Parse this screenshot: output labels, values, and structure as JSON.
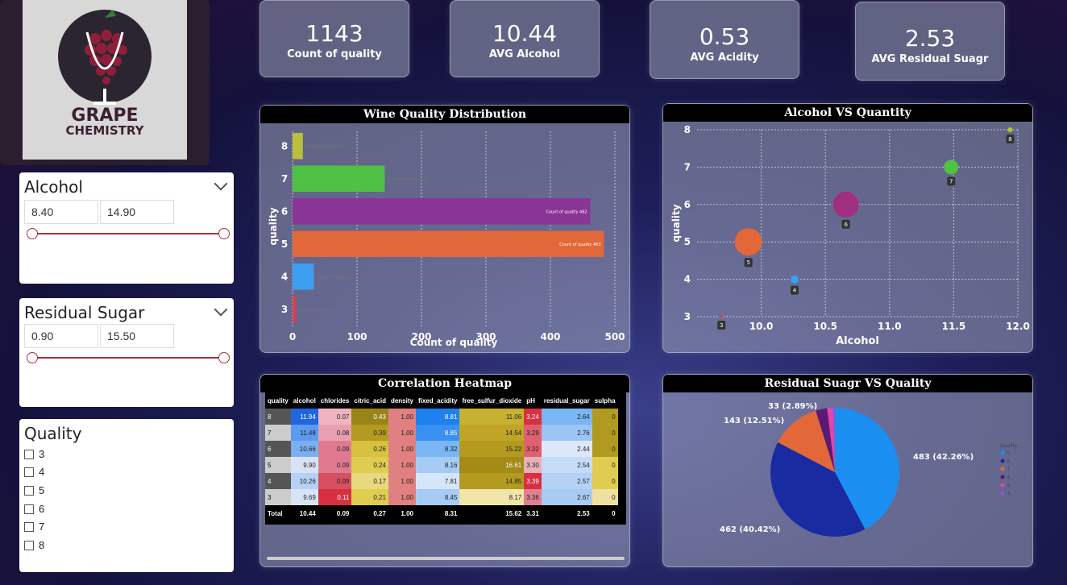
{
  "logo": {
    "line1": "GRAPE",
    "line2": "CHEMISTRY"
  },
  "kpis": [
    {
      "value": "1143",
      "label": "Count of quality"
    },
    {
      "value": "10.44",
      "label": "AVG Alcohol"
    },
    {
      "value": "0.53",
      "label": "AVG Acidity"
    },
    {
      "value": "2.53",
      "label": "AVG Residual Suagr"
    }
  ],
  "slicers": {
    "alcohol": {
      "title": "Alcohol",
      "min": "8.40",
      "max": "14.90"
    },
    "sugar": {
      "title": "Residual Sugar",
      "min": "0.90",
      "max": "15.50"
    },
    "quality": {
      "title": "Quality",
      "items": [
        "3",
        "4",
        "5",
        "6",
        "7",
        "8"
      ]
    }
  },
  "charts": {
    "bar_title": "Wine Quality Distribution",
    "scatter_title": "Alcohol VS Quantity",
    "heatmap_title": "Correlation Heatmap",
    "pie_title": "Residual Suagr VS Quality"
  },
  "chart_data": [
    {
      "type": "bar",
      "orientation": "horizontal",
      "title": "Wine Quality Distribution",
      "xlabel": "Count of quality",
      "ylabel": "quality",
      "categories": [
        "8",
        "7",
        "6",
        "5",
        "4",
        "3"
      ],
      "values": [
        16,
        143,
        462,
        483,
        33,
        6
      ],
      "colors": [
        "#b9c03a",
        "#4fc245",
        "#8a3596",
        "#e2683a",
        "#3d9ef2",
        "#d6404f"
      ],
      "data_labels": [
        "Count of quality 16",
        "Count of quality 143",
        "Count of quality 462",
        "Count of quality 483",
        "Count of quality 33",
        "Count of quality 6"
      ],
      "xticks": [
        "0",
        "100",
        "200",
        "300",
        "400",
        "500"
      ],
      "xlim": [
        0,
        500
      ]
    },
    {
      "type": "scatter",
      "title": "Alcohol VS Quantity",
      "xlabel": "Alcohol",
      "ylabel": "quality",
      "xticks": [
        "10.0",
        "10.5",
        "11.0",
        "11.5",
        "12.0"
      ],
      "yticks": [
        "3",
        "4",
        "5",
        "6",
        "7",
        "8"
      ],
      "xlim": [
        9.5,
        12.0
      ],
      "ylim": [
        3,
        8
      ],
      "points": [
        {
          "label": "3",
          "x": 9.69,
          "y": 3,
          "size": 2,
          "color": "#d6404f"
        },
        {
          "label": "4",
          "x": 10.26,
          "y": 4,
          "size": 5,
          "color": "#3d9ef2"
        },
        {
          "label": "5",
          "x": 9.9,
          "y": 5,
          "size": 17,
          "color": "#e2683a"
        },
        {
          "label": "6",
          "x": 10.66,
          "y": 6,
          "size": 16,
          "color": "#a0307f"
        },
        {
          "label": "7",
          "x": 11.48,
          "y": 7,
          "size": 9,
          "color": "#4fc245"
        },
        {
          "label": "8",
          "x": 11.94,
          "y": 8,
          "size": 3,
          "color": "#b9c03a"
        }
      ]
    },
    {
      "type": "table",
      "title": "Correlation Heatmap",
      "columns": [
        "quality",
        "alcohol",
        "chlorides",
        "citric_acid",
        "density",
        "fixed_acidity",
        "free_sulfur_dioxide",
        "pH",
        "residual_sugar",
        "sulpha"
      ],
      "rows": [
        [
          "8",
          "11.94",
          "0.07",
          "0.43",
          "1.00",
          "8.81",
          "11.06",
          "3.24",
          "2.64",
          "0"
        ],
        [
          "7",
          "11.48",
          "0.08",
          "0.39",
          "1.00",
          "8.85",
          "14.54",
          "3.29",
          "2.76",
          "0"
        ],
        [
          "6",
          "10.66",
          "0.09",
          "0.26",
          "1.00",
          "8.32",
          "15.22",
          "3.32",
          "2.44",
          "0"
        ],
        [
          "5",
          "9.90",
          "0.09",
          "0.24",
          "1.00",
          "8.16",
          "16.61",
          "3.30",
          "2.54",
          "0"
        ],
        [
          "4",
          "10.26",
          "0.09",
          "0.17",
          "1.00",
          "7.81",
          "14.85",
          "3.39",
          "2.57",
          "0"
        ],
        [
          "3",
          "9.69",
          "0.11",
          "0.21",
          "1.00",
          "8.45",
          "8.17",
          "3.36",
          "2.67",
          "0"
        ]
      ],
      "total": [
        "Total",
        "10.44",
        "0.09",
        "0.27",
        "1.00",
        "8.31",
        "15.62",
        "3.31",
        "2.53",
        "0"
      ]
    },
    {
      "type": "pie",
      "title": "Residual Suagr VS Quality",
      "legend_title": "Quality",
      "legend_position": "right",
      "slices": [
        {
          "name": "5",
          "value": 483,
          "label": "483 (42.26%)",
          "color": "#1b8ef2"
        },
        {
          "name": "6",
          "value": 462,
          "label": "462 (40.42%)",
          "color": "#1a2aa0"
        },
        {
          "name": "7",
          "value": 143,
          "label": "143 (12.51%)",
          "color": "#e2683a"
        },
        {
          "name": "4",
          "value": 33,
          "label": "33 (2.89%)",
          "color": "#5b1a73"
        },
        {
          "name": "8",
          "value": 16,
          "label": "",
          "color": "#e447a8"
        },
        {
          "name": "3",
          "value": 6,
          "label": "",
          "color": "#8c5ad6"
        }
      ]
    }
  ],
  "colors": {
    "accent": "#a3343d",
    "panel_header": "#000000"
  }
}
